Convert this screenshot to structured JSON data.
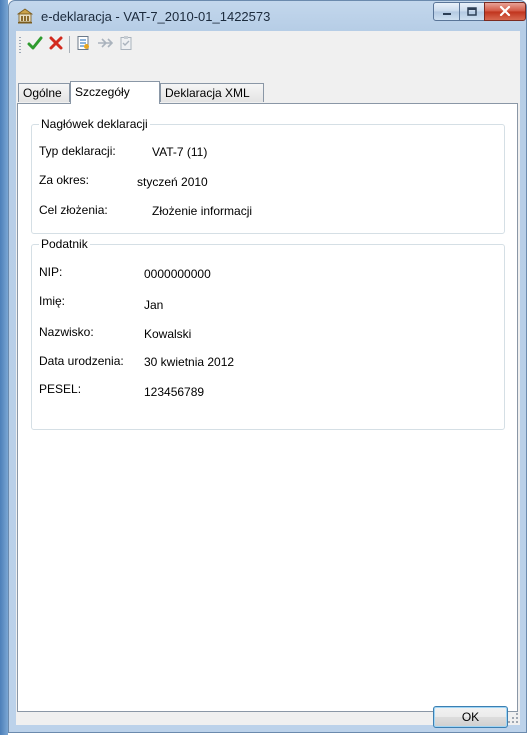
{
  "window": {
    "title": "e-deklaracja - VAT-7_2010-01_1422573",
    "icon": "building-icon",
    "controls": {
      "minimize_icon": "minimize-icon",
      "maximize_icon": "maximize-icon",
      "close_icon": "close-icon"
    }
  },
  "toolbar": {
    "buttons": [
      {
        "name": "accept",
        "icon": "checkmark-icon",
        "color": "#2e9b2e"
      },
      {
        "name": "reject",
        "icon": "x-icon",
        "color": "#d22a1e"
      },
      {
        "name": "document",
        "icon": "document-icon"
      },
      {
        "name": "forward",
        "icon": "double-arrow-icon"
      },
      {
        "name": "clipboard",
        "icon": "clipboard-icon"
      }
    ]
  },
  "tabs": [
    {
      "label": "Ogólne",
      "active": false
    },
    {
      "label": "Szczegóły",
      "active": true
    },
    {
      "label": "Deklaracja XML",
      "active": false
    }
  ],
  "header_group": {
    "title": "Nagłówek deklaracji",
    "rows": [
      {
        "label": "Typ deklaracji:",
        "value": "VAT-7 (11)"
      },
      {
        "label": "Za okres:",
        "value": "styczeń 2010"
      },
      {
        "label": "Cel złożenia:",
        "value": "Złożenie informacji"
      }
    ]
  },
  "taxpayer_group": {
    "title": "Podatnik",
    "rows": [
      {
        "label": "NIP:",
        "value": "0000000000"
      },
      {
        "label": "Imię:",
        "value": "Jan"
      },
      {
        "label": "Nazwisko:",
        "value": "Kowalski"
      },
      {
        "label": "Data urodzenia:",
        "value": "30 kwietnia 2012"
      },
      {
        "label": "PESEL:",
        "value": "123456789"
      }
    ]
  },
  "footer": {
    "ok_label": "OK"
  }
}
